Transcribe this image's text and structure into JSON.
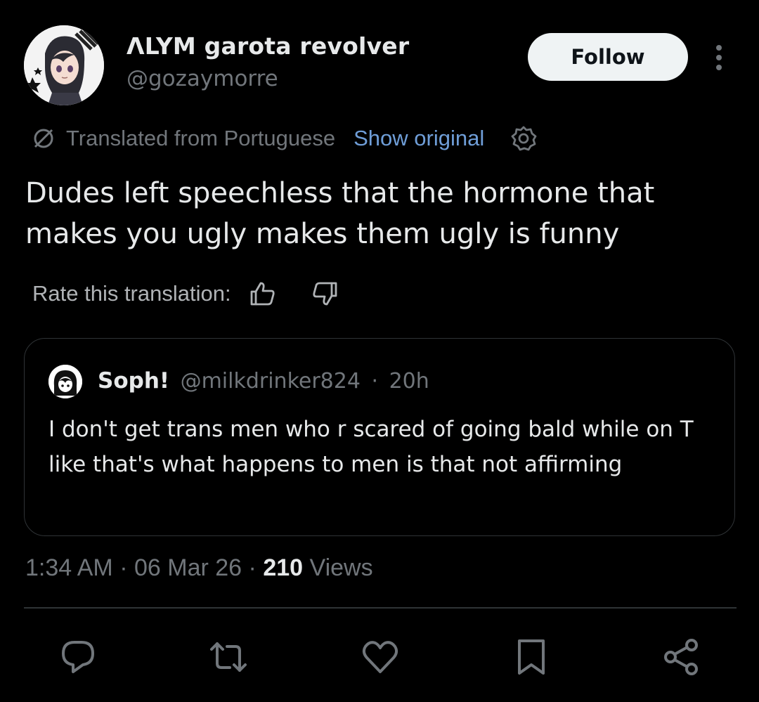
{
  "author": {
    "display_name": "ΛLYM garota revolver",
    "handle": "@gozaymorre",
    "follow_label": "Follow"
  },
  "translation": {
    "translated_from": "Translated from Portuguese",
    "show_original": "Show original",
    "rate_label": "Rate this translation:"
  },
  "tweet": {
    "text": "Dudes left speechless that the hormone that makes you ugly makes them ugly is funny"
  },
  "quote": {
    "name": "Soph!",
    "handle": "@milkdrinker824",
    "separator": "·",
    "time": "20h",
    "text": "I don't get trans men who r scared of going bald while on T like that's what happens to men is that not affirming"
  },
  "meta": {
    "time": "1:34 AM",
    "sep1": "·",
    "date": "06 Mar 26",
    "sep2": "·",
    "views_count": "210",
    "views_label": "Views"
  },
  "actions": [
    "reply-icon",
    "repost-icon",
    "like-icon",
    "bookmark-icon",
    "share-icon"
  ],
  "colors": {
    "background": "#000000",
    "primary_text": "#e7e9ea",
    "secondary_text": "#71767b",
    "link": "#6f9ed8",
    "follow_bg": "#eff3f4",
    "border": "#2f3336"
  }
}
